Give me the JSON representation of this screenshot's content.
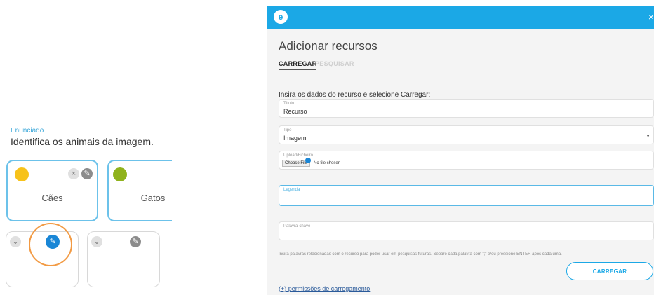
{
  "editor": {
    "enunciado_label": "Enunciado",
    "enunciado_value": "Identifica os animais da imagem.",
    "cards": [
      {
        "label": "Cães",
        "dot_color": "#f7c21a"
      },
      {
        "label": "Gatos",
        "dot_color": "#8fb21c"
      }
    ],
    "icons": {
      "remove": "×",
      "edit": "✎",
      "expand": "⌄"
    }
  },
  "modal": {
    "logo": "e",
    "close": "×",
    "title": "Adicionar recursos",
    "tabs": [
      {
        "label": "CARREGAR",
        "active": true
      },
      {
        "label": "PESQUISAR",
        "active": false
      }
    ],
    "instruction": "Insira os dados do recurso e selecione Carregar:",
    "fields": {
      "titulo": {
        "label": "Título",
        "value": "Recurso"
      },
      "tipo": {
        "label": "Tipo",
        "value": "Imagem"
      },
      "upload": {
        "label": "Upload/Ficheiro",
        "button": "Choose File",
        "status": "No file chosen"
      },
      "legenda": {
        "label": "Legenda",
        "value": ""
      },
      "palavras": {
        "label": "Palavra-chave",
        "value": ""
      }
    },
    "help_text": "Insira palavras relacionadas com o recurso para poder usar em pesquisas futuras. Separe cada palavra com \";\" e/ou pressione ENTER após cada uma.",
    "upload_button": "CARREGAR",
    "permissions_link": "(+) permissões de carregamento"
  },
  "colors": {
    "accent": "#1ba8e6",
    "card_border": "#6cc2ea",
    "highlight_ring": "#f29a43"
  }
}
